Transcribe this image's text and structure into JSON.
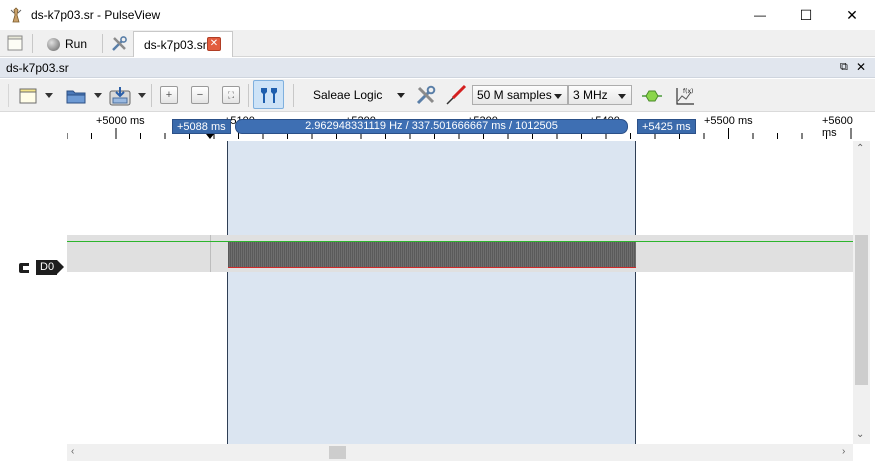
{
  "window": {
    "title": "ds-k7p03.sr - PulseView",
    "minimize": "—",
    "maximize": "☐",
    "close": "✕"
  },
  "toolbar": {
    "run_label": "Run",
    "tab_label": "ds-k7p03.sr",
    "tab_close": "✕"
  },
  "dock": {
    "title": "ds-k7p03.sr",
    "float_icon": "⧉",
    "close_icon": "✕"
  },
  "session": {
    "device": "Saleae Logic",
    "samples": "50 M samples",
    "samplerate": "3 MHz"
  },
  "ruler": {
    "labels": [
      "+5000 ms",
      "+5100",
      "+5200",
      "+5300",
      "+5400",
      "+5500 ms",
      "+5600 ms"
    ],
    "cursor_left": "+5088 ms",
    "cursor_right": "+5425 ms",
    "cursor_measure": "2.962948331119 Hz / 337.501666667 ms / 1012505"
  },
  "channels": [
    {
      "name": "D0"
    }
  ],
  "colors": {
    "accent": "#3e6fb3",
    "selection": "#dbe5f1",
    "trace_high": "#2db52d",
    "trace_low": "#d02a2a"
  },
  "icons": {
    "app": "pulseview-probe-icon",
    "new_session": "new-session-icon",
    "run": "run-dot-icon",
    "device_tools": "tools-icon",
    "new_view": "new-view-icon",
    "open": "open-folder-icon",
    "save": "save-icon",
    "zoom_in": "zoom-in-icon",
    "zoom_out": "zoom-out-icon",
    "zoom_fit": "zoom-fit-icon",
    "cursor": "cursor-icon",
    "config": "tools-icon",
    "probe": "probe-icon",
    "decoder": "decoder-icon",
    "math": "math-channel-icon"
  }
}
